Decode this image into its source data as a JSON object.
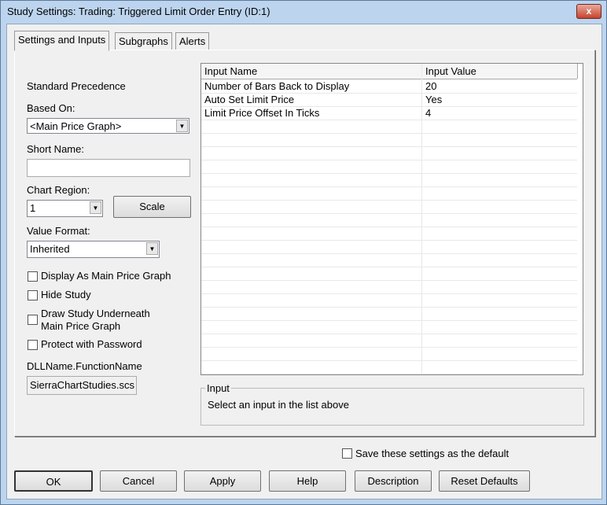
{
  "window": {
    "title": "Study Settings: Trading: Triggered Limit Order Entry (ID:1)",
    "close": "x"
  },
  "tabs": [
    "Settings and Inputs",
    "Subgraphs",
    "Alerts"
  ],
  "left": {
    "precedence": "Standard Precedence",
    "based_on_label": "Based On:",
    "based_on_value": "<Main Price Graph>",
    "short_name_label": "Short Name:",
    "short_name_value": "",
    "chart_region_label": "Chart Region:",
    "chart_region_value": "1",
    "scale_button": "Scale",
    "value_format_label": "Value Format:",
    "value_format_value": "Inherited",
    "checkboxes": [
      "Display As Main Price Graph",
      "Hide Study",
      "Draw Study Underneath",
      "Main Price Graph",
      "Protect with Password"
    ],
    "dll_label": "DLLName.FunctionName",
    "dll_value": "SierraChartStudies.scs"
  },
  "inputs_table": {
    "headers": [
      "Input Name",
      "Input Value"
    ],
    "rows": [
      [
        "Number of Bars Back to Display",
        "20"
      ],
      [
        "Auto Set Limit Price",
        "Yes"
      ],
      [
        "Limit Price Offset In Ticks",
        "4"
      ]
    ]
  },
  "input_box": {
    "label": "Input",
    "text": "Select an input in the list above"
  },
  "save_default": "Save these settings as the default",
  "buttons": [
    "OK",
    "Cancel",
    "Apply",
    "Help",
    "Description",
    "Reset Defaults"
  ]
}
